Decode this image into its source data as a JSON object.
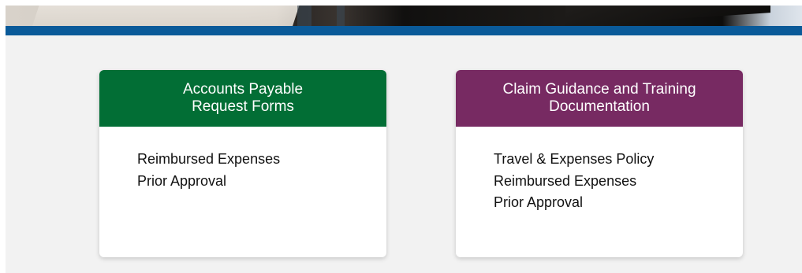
{
  "colors": {
    "band": "#0a5a99",
    "page_background": "#f2f2f2",
    "card_left_header": "#026e35",
    "card_right_header": "#772a62",
    "card_background": "#ffffff",
    "link_text": "#111111"
  },
  "cards": [
    {
      "title_line1": "Accounts Payable",
      "title_line2": "Request Forms",
      "links": [
        "Reimbursed Expenses",
        "Prior Approval"
      ]
    },
    {
      "title_line1": "Claim Guidance and Training",
      "title_line2": "Documentation",
      "links": [
        "Travel & Expenses Policy",
        "Reimbursed Expenses",
        "Prior Approval"
      ]
    }
  ]
}
